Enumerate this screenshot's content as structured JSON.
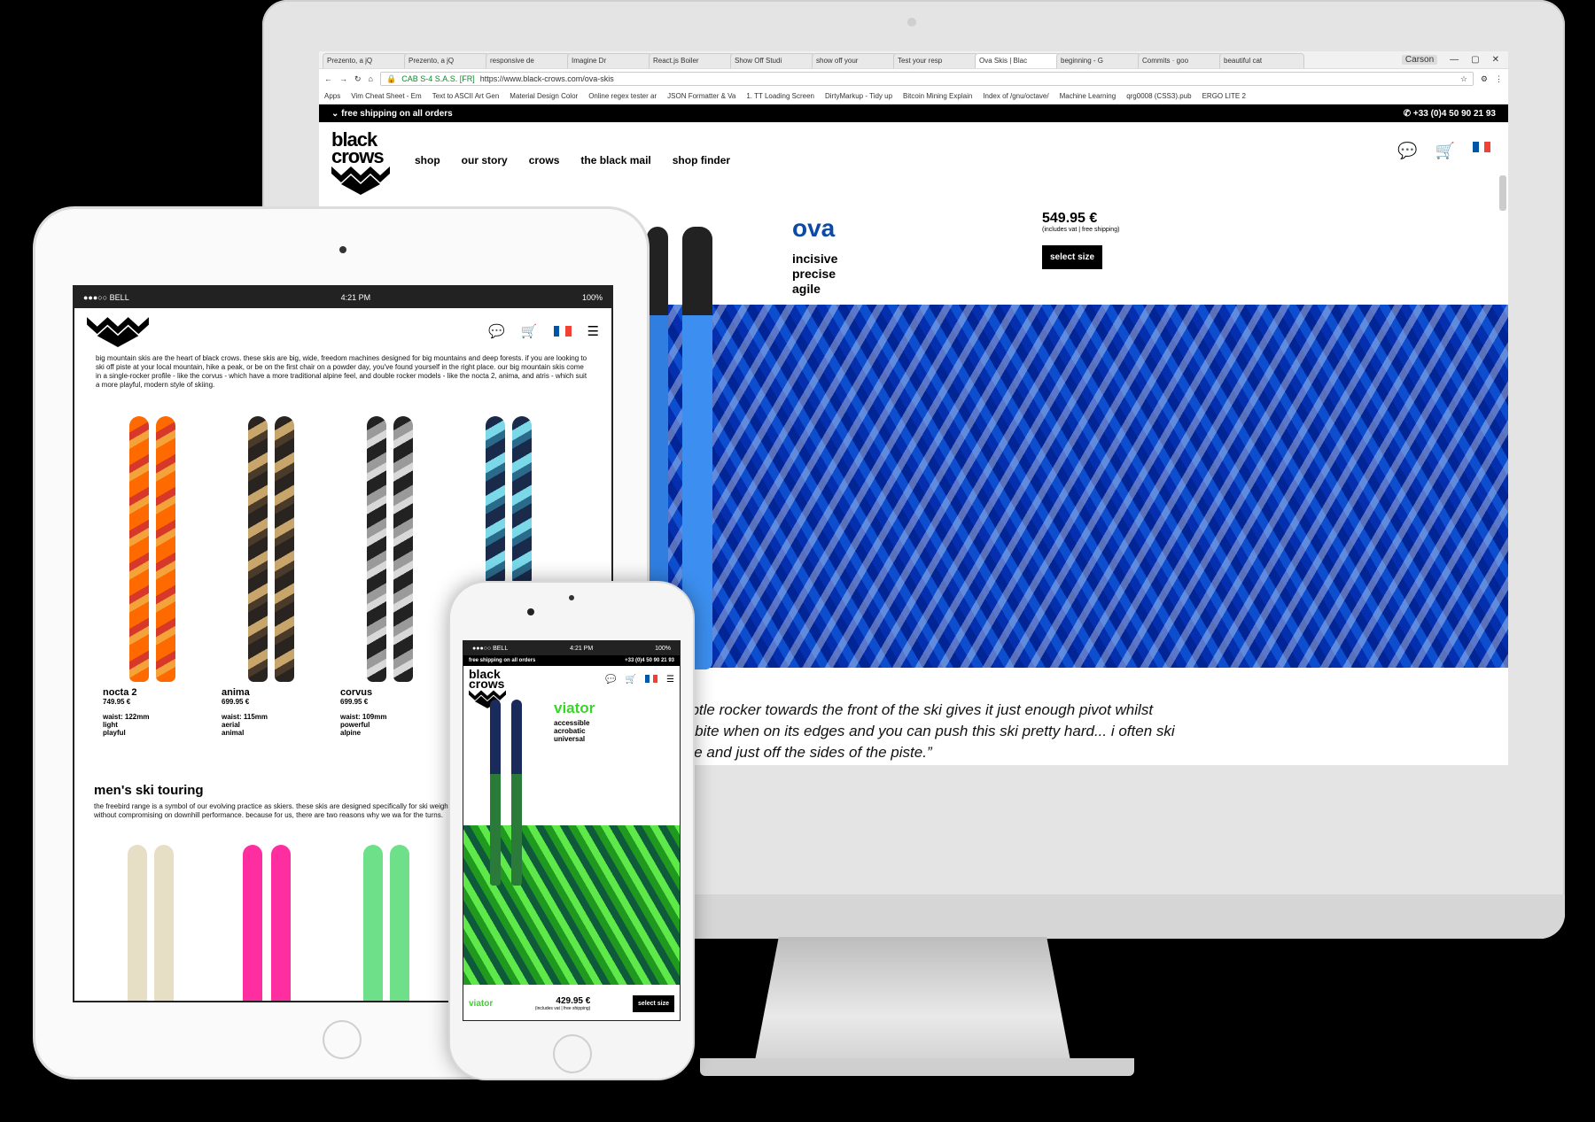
{
  "colors": {
    "brand_blue": "#0c4aa6",
    "brand_green": "#39d52a",
    "orange": "#ff6a00",
    "pink": "#ff2ea0",
    "mint": "#6fe08a",
    "black": "#000000"
  },
  "desktop": {
    "tabs": [
      "Prezento, a jQ",
      "Prezento, a jQ",
      "responsive de",
      "Imagine Dr",
      "React.js Boiler",
      "Show Off Studi",
      "show off your",
      "Test your resp",
      "Ova Skis | Blac",
      "beginning - G",
      "Commits · goo",
      "beautiful cat"
    ],
    "active_tab_index": 8,
    "window_label": "Carson",
    "url_secure_label": "CAB S-4 S.A.S. [FR]",
    "url": "https://www.black-crows.com/ova-skis",
    "bookmarks": [
      "Apps",
      "Vim Cheat Sheet - Em",
      "Text to ASCII Art Gen",
      "Material Design Color",
      "Online regex tester ar",
      "JSON Formatter & Va",
      "1. TT Loading Screen",
      "DirtyMarkup - Tidy up",
      "Bitcoin Mining Explain",
      "Index of /gnu/octave/",
      "Machine Learning",
      "qrg0008 (CSS3).pub",
      "ERGO LITE 2"
    ],
    "topbar_left": "free shipping on all orders",
    "topbar_right": "+33 (0)4 50 90 21 93",
    "logo_line1": "black",
    "logo_line2": "crows",
    "nav": [
      "shop",
      "our story",
      "crows",
      "the black mail",
      "shop finder"
    ],
    "product_name": "ova",
    "tagline": [
      "incisive",
      "precise",
      "agile"
    ],
    "price": "549.95 €",
    "price_note": "(includes vat | free shipping)",
    "select_size": "select size",
    "quote_lines": [
      "ubtle rocker towards the front of the ski gives it just enough pivot whilst",
      "d bite when on its edges and you can push this ski pretty hard... i often ski",
      "ste and just off the sides of the piste.”"
    ],
    "ski_brand": "black crows"
  },
  "tablet": {
    "carrier": "●●●○○ BELL",
    "time": "4:21 PM",
    "battery": "100%",
    "intro": "big mountain skis are the heart of black crows. these skis are big, wide, freedom machines designed for big mountains and deep forests. if you are looking to ski off piste at your local mountain, hike a peak, or be on the first chair on a powder day, you've found yourself in the right place. our big mountain skis come in a single-rocker profile - like the corvus - which have a more traditional alpine feel, and double rocker models - like the nocta 2, anima, and atris - which suit a more playful, modern style of skiing.",
    "skis": [
      {
        "name": "nocta 2",
        "price": "749.95 €",
        "waist": "waist: 122mm",
        "t1": "light",
        "t2": "playful"
      },
      {
        "name": "anima",
        "price": "699.95 €",
        "waist": "waist: 115mm",
        "t1": "aerial",
        "t2": "animal"
      },
      {
        "name": "corvus",
        "price": "699.95 €",
        "waist": "waist: 109mm",
        "t1": "powerful",
        "t2": "alpine"
      }
    ],
    "section_title": "men's ski touring",
    "section_text": "the freebird range is a symbol of our evolving practice as skiers. these skis are designed specifically for ski weight without compromising on downhill performance. because for us, there are two reasons why we wa for the turns."
  },
  "phone": {
    "carrier": "●●●○○ BELL",
    "time": "4:21 PM",
    "battery": "100%",
    "topbar_left": "free shipping on all orders",
    "topbar_right": "+33 (0)4 50 90 21 93",
    "logo_line1": "black",
    "logo_line2": "crows",
    "product_name": "viator",
    "tagline": [
      "accessible",
      "acrobatic",
      "universal"
    ],
    "footer_name": "viator",
    "price": "429.95 €",
    "price_note": "(includes vat | free shipping)",
    "select_size": "select size"
  }
}
